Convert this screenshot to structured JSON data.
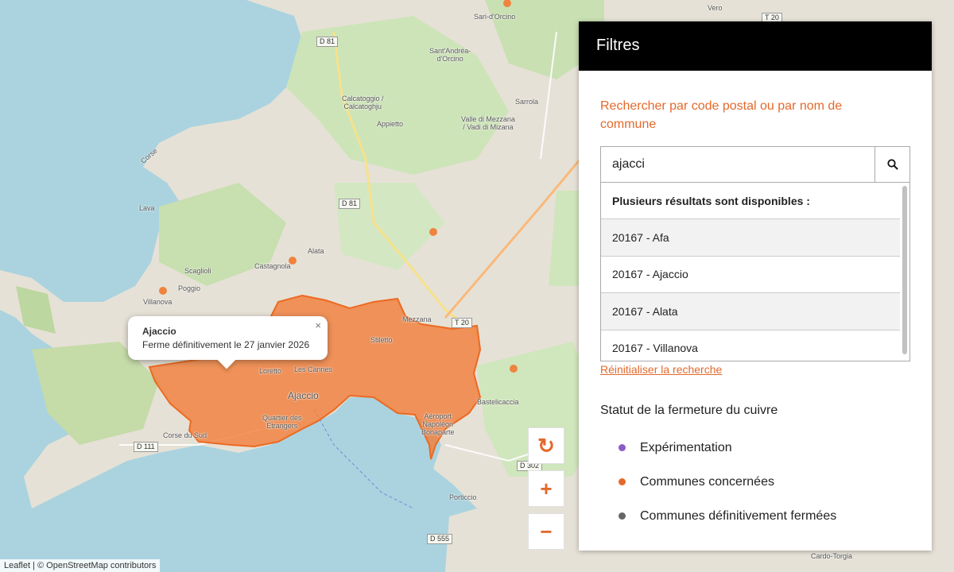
{
  "map": {
    "popup": {
      "title": "Ajaccio",
      "text": "Ferme définitivement le 27 janvier 2026",
      "close_label": "×"
    },
    "controls": {
      "refresh_label": "↻",
      "zoom_in_label": "+",
      "zoom_out_label": "−"
    },
    "attribution": "Leaflet | © OpenStreetMap contributors",
    "highlight_color": "#f07f3c",
    "places": [
      {
        "name": "Sari-d'Orcino"
      },
      {
        "name": "Sant'Andréa-\nd'Orcino"
      },
      {
        "name": "Calcatoggio /\nCalcatoghju"
      },
      {
        "name": "Sarrola"
      },
      {
        "name": "Valle di Mezzana\n/ Vadi di Mizana"
      },
      {
        "name": "Appietto"
      },
      {
        "name": "Lava"
      },
      {
        "name": "Alata"
      },
      {
        "name": "Castagnola"
      },
      {
        "name": "Scaglioli"
      },
      {
        "name": "Poggio"
      },
      {
        "name": "Villanova"
      },
      {
        "name": "Mezzana"
      },
      {
        "name": "Stiletto"
      },
      {
        "name": "Loretto"
      },
      {
        "name": "Les Cannes"
      },
      {
        "name": "Ajaccio"
      },
      {
        "name": "Quartier des\nEtrangers"
      },
      {
        "name": "Aéroport\nNapoléon\nBonaparte"
      },
      {
        "name": "Bastelicaccia"
      },
      {
        "name": "Porticcio"
      },
      {
        "name": "Vero"
      },
      {
        "name": "Cardo-Torgia"
      },
      {
        "name": "Corse"
      },
      {
        "name": "Corse du Sud"
      }
    ],
    "roads": [
      {
        "label": "D 81"
      },
      {
        "label": "D 81"
      },
      {
        "label": "T 20"
      },
      {
        "label": "T 20"
      },
      {
        "label": "D 111"
      },
      {
        "label": "D 302"
      },
      {
        "label": "D 555"
      }
    ]
  },
  "panel": {
    "title": "Filtres",
    "search_label": "Rechercher par code postal ou par nom de commune",
    "search_value": "ajacci",
    "search_icon": "search-icon",
    "results_heading": "Plusieurs résultats sont disponibles :",
    "results": [
      {
        "label": "20167 - Afa"
      },
      {
        "label": "20167 - Ajaccio"
      },
      {
        "label": "20167 - Alata"
      },
      {
        "label": "20167 - Villanova"
      }
    ],
    "reset_label": "Réinitialiser la recherche",
    "status_title": "Statut de la fermeture du cuivre",
    "legend": [
      {
        "label": "Expérimentation",
        "color": "#8a5cc7"
      },
      {
        "label": "Communes concernées",
        "color": "#e4692b"
      },
      {
        "label": "Communes définitivement fermées",
        "color": "#666666"
      }
    ]
  },
  "accent_color": "#e4692b"
}
